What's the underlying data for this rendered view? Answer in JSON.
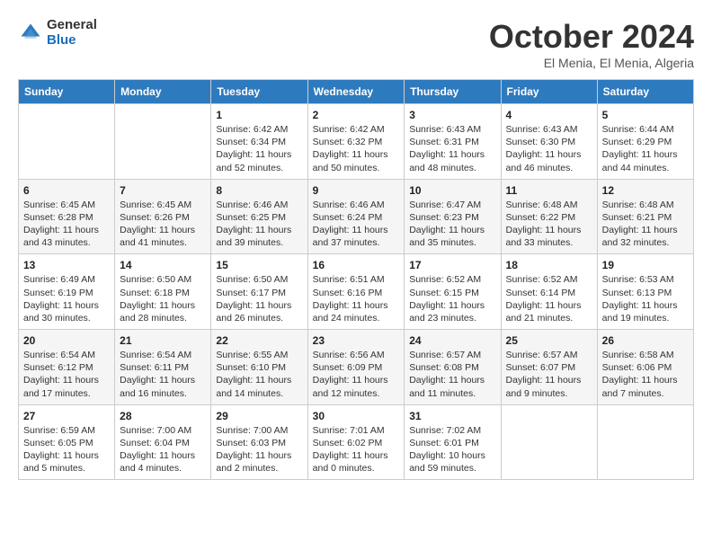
{
  "logo": {
    "general": "General",
    "blue": "Blue"
  },
  "header": {
    "month": "October 2024",
    "location": "El Menia, El Menia, Algeria"
  },
  "weekdays": [
    "Sunday",
    "Monday",
    "Tuesday",
    "Wednesday",
    "Thursday",
    "Friday",
    "Saturday"
  ],
  "weeks": [
    [
      null,
      null,
      {
        "day": 1,
        "sunrise": "6:42 AM",
        "sunset": "6:34 PM",
        "daylight": "11 hours and 52 minutes."
      },
      {
        "day": 2,
        "sunrise": "6:42 AM",
        "sunset": "6:32 PM",
        "daylight": "11 hours and 50 minutes."
      },
      {
        "day": 3,
        "sunrise": "6:43 AM",
        "sunset": "6:31 PM",
        "daylight": "11 hours and 48 minutes."
      },
      {
        "day": 4,
        "sunrise": "6:43 AM",
        "sunset": "6:30 PM",
        "daylight": "11 hours and 46 minutes."
      },
      {
        "day": 5,
        "sunrise": "6:44 AM",
        "sunset": "6:29 PM",
        "daylight": "11 hours and 44 minutes."
      }
    ],
    [
      {
        "day": 6,
        "sunrise": "6:45 AM",
        "sunset": "6:28 PM",
        "daylight": "11 hours and 43 minutes."
      },
      {
        "day": 7,
        "sunrise": "6:45 AM",
        "sunset": "6:26 PM",
        "daylight": "11 hours and 41 minutes."
      },
      {
        "day": 8,
        "sunrise": "6:46 AM",
        "sunset": "6:25 PM",
        "daylight": "11 hours and 39 minutes."
      },
      {
        "day": 9,
        "sunrise": "6:46 AM",
        "sunset": "6:24 PM",
        "daylight": "11 hours and 37 minutes."
      },
      {
        "day": 10,
        "sunrise": "6:47 AM",
        "sunset": "6:23 PM",
        "daylight": "11 hours and 35 minutes."
      },
      {
        "day": 11,
        "sunrise": "6:48 AM",
        "sunset": "6:22 PM",
        "daylight": "11 hours and 33 minutes."
      },
      {
        "day": 12,
        "sunrise": "6:48 AM",
        "sunset": "6:21 PM",
        "daylight": "11 hours and 32 minutes."
      }
    ],
    [
      {
        "day": 13,
        "sunrise": "6:49 AM",
        "sunset": "6:19 PM",
        "daylight": "11 hours and 30 minutes."
      },
      {
        "day": 14,
        "sunrise": "6:50 AM",
        "sunset": "6:18 PM",
        "daylight": "11 hours and 28 minutes."
      },
      {
        "day": 15,
        "sunrise": "6:50 AM",
        "sunset": "6:17 PM",
        "daylight": "11 hours and 26 minutes."
      },
      {
        "day": 16,
        "sunrise": "6:51 AM",
        "sunset": "6:16 PM",
        "daylight": "11 hours and 24 minutes."
      },
      {
        "day": 17,
        "sunrise": "6:52 AM",
        "sunset": "6:15 PM",
        "daylight": "11 hours and 23 minutes."
      },
      {
        "day": 18,
        "sunrise": "6:52 AM",
        "sunset": "6:14 PM",
        "daylight": "11 hours and 21 minutes."
      },
      {
        "day": 19,
        "sunrise": "6:53 AM",
        "sunset": "6:13 PM",
        "daylight": "11 hours and 19 minutes."
      }
    ],
    [
      {
        "day": 20,
        "sunrise": "6:54 AM",
        "sunset": "6:12 PM",
        "daylight": "11 hours and 17 minutes."
      },
      {
        "day": 21,
        "sunrise": "6:54 AM",
        "sunset": "6:11 PM",
        "daylight": "11 hours and 16 minutes."
      },
      {
        "day": 22,
        "sunrise": "6:55 AM",
        "sunset": "6:10 PM",
        "daylight": "11 hours and 14 minutes."
      },
      {
        "day": 23,
        "sunrise": "6:56 AM",
        "sunset": "6:09 PM",
        "daylight": "11 hours and 12 minutes."
      },
      {
        "day": 24,
        "sunrise": "6:57 AM",
        "sunset": "6:08 PM",
        "daylight": "11 hours and 11 minutes."
      },
      {
        "day": 25,
        "sunrise": "6:57 AM",
        "sunset": "6:07 PM",
        "daylight": "11 hours and 9 minutes."
      },
      {
        "day": 26,
        "sunrise": "6:58 AM",
        "sunset": "6:06 PM",
        "daylight": "11 hours and 7 minutes."
      }
    ],
    [
      {
        "day": 27,
        "sunrise": "6:59 AM",
        "sunset": "6:05 PM",
        "daylight": "11 hours and 5 minutes."
      },
      {
        "day": 28,
        "sunrise": "7:00 AM",
        "sunset": "6:04 PM",
        "daylight": "11 hours and 4 minutes."
      },
      {
        "day": 29,
        "sunrise": "7:00 AM",
        "sunset": "6:03 PM",
        "daylight": "11 hours and 2 minutes."
      },
      {
        "day": 30,
        "sunrise": "7:01 AM",
        "sunset": "6:02 PM",
        "daylight": "11 hours and 0 minutes."
      },
      {
        "day": 31,
        "sunrise": "7:02 AM",
        "sunset": "6:01 PM",
        "daylight": "10 hours and 59 minutes."
      },
      null,
      null
    ]
  ]
}
